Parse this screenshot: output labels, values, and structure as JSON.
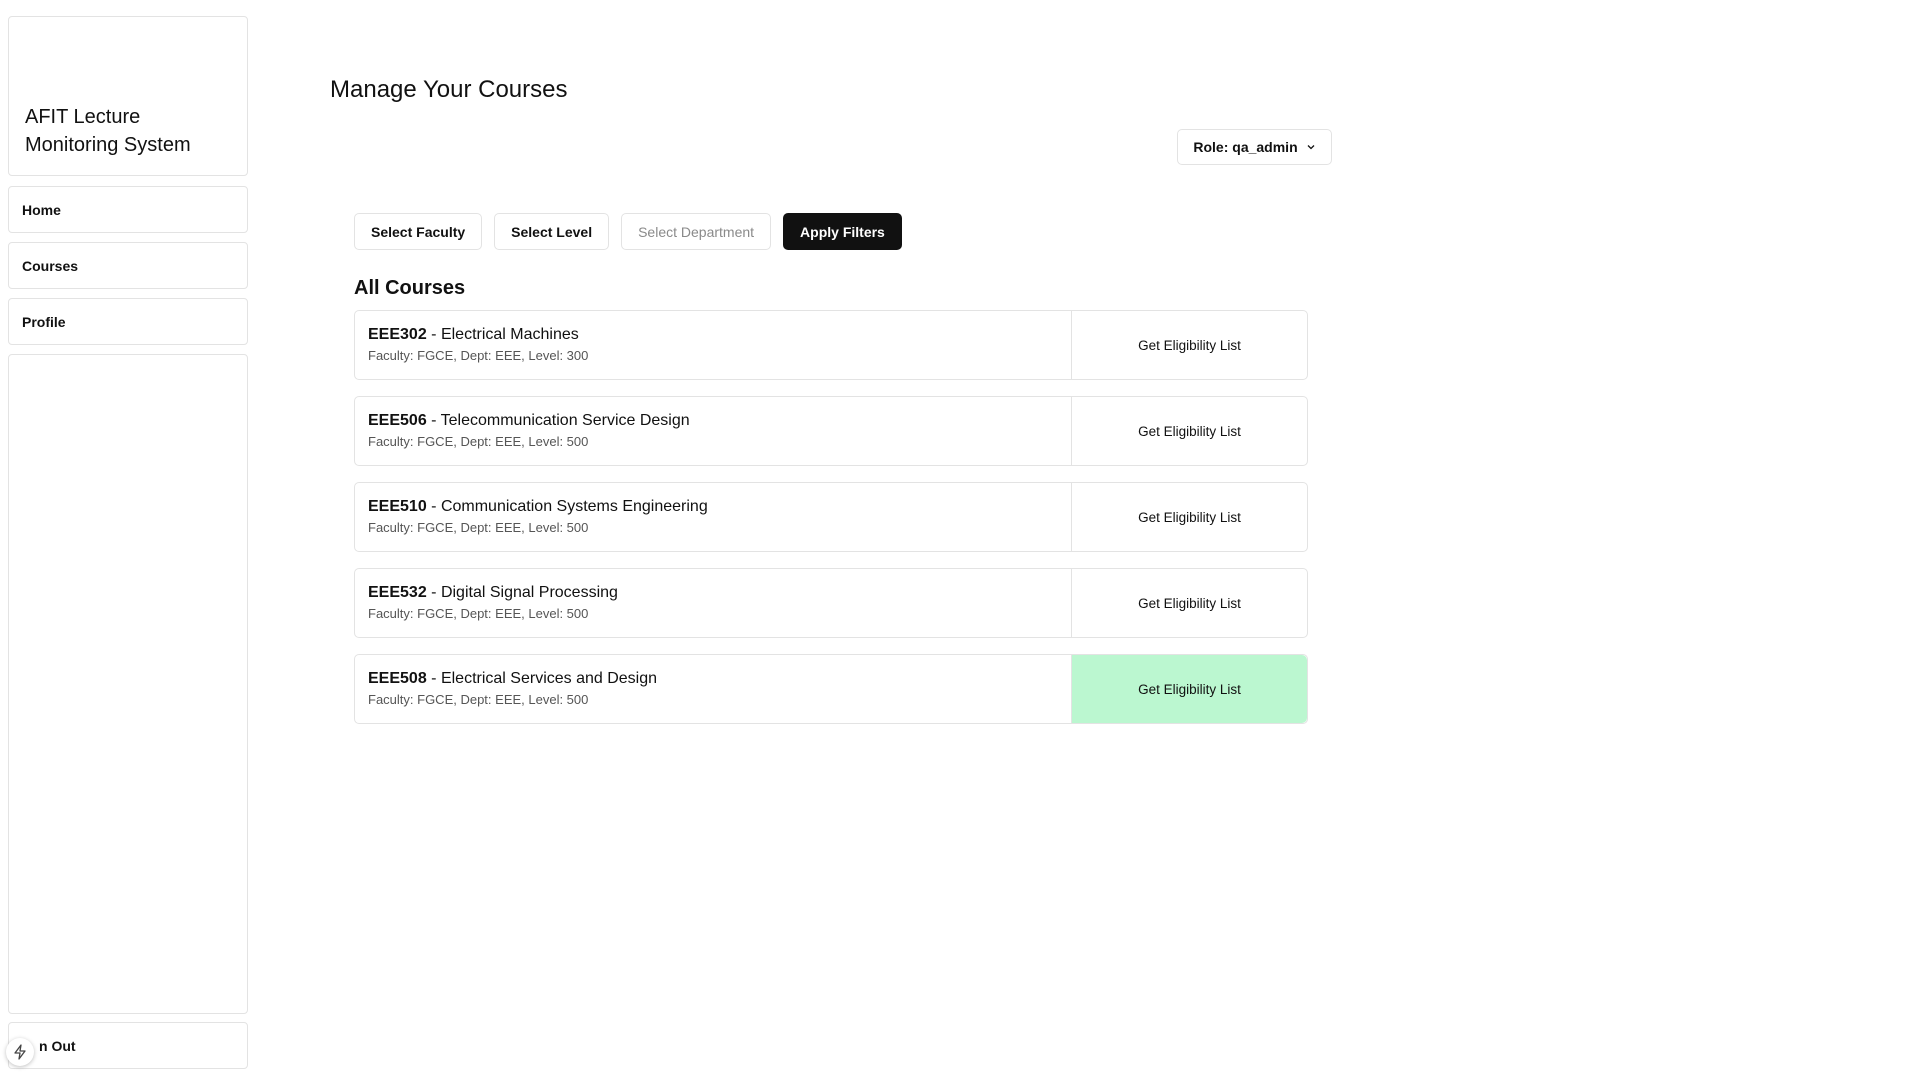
{
  "sidebar": {
    "brand": "AFIT Lecture Monitoring System",
    "items": [
      {
        "label": "Home"
      },
      {
        "label": "Courses"
      },
      {
        "label": "Profile"
      }
    ],
    "signout_label": "n Out"
  },
  "header": {
    "title": "Manage Your Courses",
    "role_label": "Role: qa_admin"
  },
  "filters": {
    "faculty": "Select Faculty",
    "level": "Select Level",
    "department": "Select Department",
    "apply": "Apply Filters"
  },
  "courses_section": {
    "title": "All Courses",
    "button_label": "Get Eligibility List",
    "highlight_color": "#bbf7d0",
    "courses": [
      {
        "code": "EEE302",
        "name": " - Electrical Machines",
        "meta": "Faculty: FGCE, Dept: EEE, Level: 300"
      },
      {
        "code": "EEE506",
        "name": " - Telecommunication Service Design",
        "meta": "Faculty: FGCE, Dept: EEE, Level: 500"
      },
      {
        "code": "EEE510",
        "name": " - Communication Systems Engineering",
        "meta": "Faculty: FGCE, Dept: EEE, Level: 500"
      },
      {
        "code": "EEE532",
        "name": " - Digital Signal Processing",
        "meta": "Faculty: FGCE, Dept: EEE, Level: 500"
      },
      {
        "code": "EEE508",
        "name": " - Electrical Services and Design",
        "meta": "Faculty: FGCE, Dept: EEE, Level: 500"
      }
    ]
  }
}
